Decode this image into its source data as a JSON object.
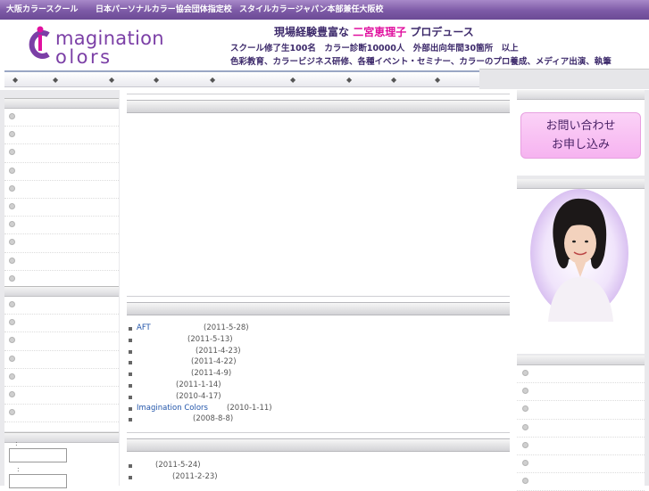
{
  "topbar": {
    "items": [
      "大阪カラースクール",
      "日本パーソナルカラー協会団体指定校",
      "スタイルカラージャパン本部兼任大阪校"
    ]
  },
  "header": {
    "logo": {
      "line1": "magination",
      "line2": "olors",
      "text": "Imagination Colors"
    },
    "tagline1_prefix": "現場経験豊富な",
    "tagline1_name": "二宮恵理子",
    "tagline1_suffix": "プロデュース",
    "tagline2": "スクール修了生100名　カラー診断10000人　外部出向年間30箇所　以上",
    "tagline3": "色彩教育、カラービジネス研修、各種イベント・セミナー、カラーのプロ養成、メディア出演、執筆"
  },
  "nav": {
    "diamond": "◆",
    "count": 9
  },
  "news1": [
    {
      "title": "AFT",
      "date": "(2011-5-28)"
    },
    {
      "title": "",
      "date": "(2011-5-13)"
    },
    {
      "title": "",
      "date": "(2011-4-23)"
    },
    {
      "title": "",
      "date": "(2011-4-22)"
    },
    {
      "title": "",
      "date": "(2011-4-9)"
    },
    {
      "title": "",
      "date": "(2011-1-14)"
    },
    {
      "title": "",
      "date": "(2010-4-17)"
    },
    {
      "title": "Imagination Colors",
      "date": "(2010-1-11)"
    },
    {
      "title": "",
      "date": "(2008-8-8)"
    }
  ],
  "news2": [
    {
      "title": "",
      "date": "(2011-5-24)"
    },
    {
      "title": "",
      "date": "(2011-2-23)"
    }
  ],
  "contact": {
    "line1": "お問い合わせ",
    "line2": "お申し込み"
  },
  "form": {
    "label1": ":",
    "label2": ":"
  },
  "colors": {
    "topbar": "#7d5aa6",
    "logo": "#7b3fa6",
    "accent_name": "#e0119f",
    "contact_bg": "#f6b3f0"
  }
}
